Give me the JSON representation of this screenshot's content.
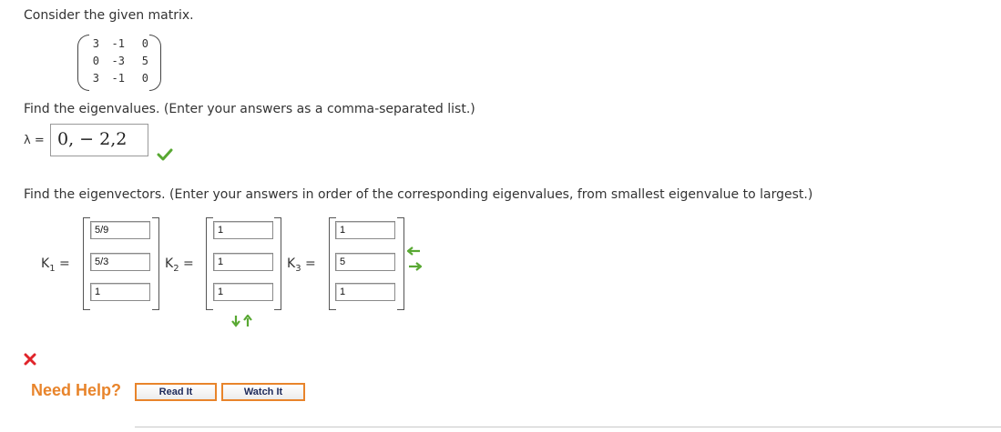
{
  "question": {
    "intro": "Consider the given matrix.",
    "matrix": [
      [
        "3",
        "-1",
        "0"
      ],
      [
        "0",
        "-3",
        "5"
      ],
      [
        "3",
        "-1",
        "0"
      ]
    ],
    "eigenvalues_prompt": "Find the eigenvalues. (Enter your answers as a comma-separated list.)",
    "lambda_label": "λ =",
    "eigenvalues_answer": "0, − 2,2",
    "eigenvectors_prompt": "Find the eigenvectors. (Enter your answers in order of the corresponding eigenvalues, from smallest eigenvalue to largest.)"
  },
  "vectors": [
    {
      "label": "K",
      "sub": "1",
      "eq": "=",
      "entries": [
        "5/9",
        "5/3",
        "1"
      ]
    },
    {
      "label": "K",
      "sub": "2",
      "eq": "=",
      "entries": [
        "1",
        "1",
        "1"
      ]
    },
    {
      "label": "K",
      "sub": "3",
      "eq": "=",
      "entries": [
        "1",
        "5",
        "1"
      ]
    }
  ],
  "help": {
    "title": "Need Help?",
    "read_it": "Read It",
    "watch_it": "Watch It"
  },
  "colors": {
    "correct": "#58a832",
    "incorrect": "#e0242a",
    "help_accent": "#e8842b",
    "arrow": "#58a832"
  },
  "icons": {
    "correct_mark": "check-icon",
    "incorrect_mark": "x-icon",
    "reorder_horizontal": "left-right-arrows-icon",
    "reorder_vertical": "down-up-arrows-icon"
  }
}
